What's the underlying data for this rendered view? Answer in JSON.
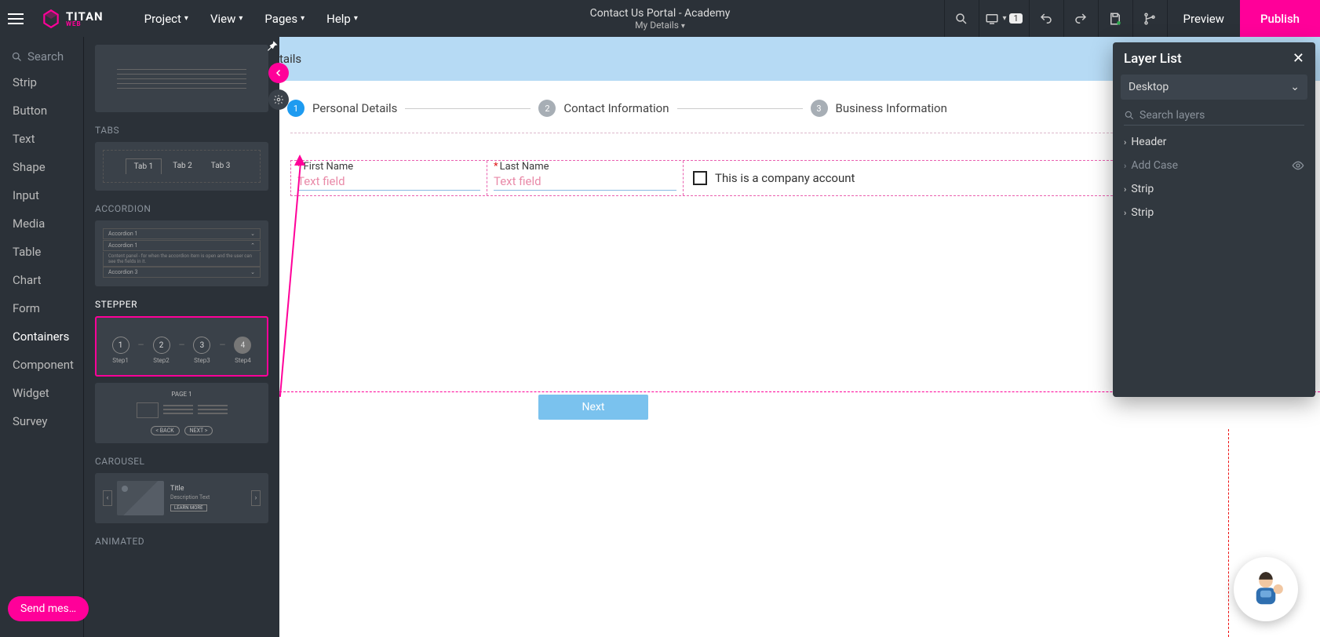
{
  "brand": {
    "name": "TITAN",
    "sub": "WEB"
  },
  "topmenu": {
    "project": "Project",
    "view": "View",
    "pages": "Pages",
    "help": "Help"
  },
  "doc": {
    "title": "Contact Us Portal - Academy",
    "page": "My Details"
  },
  "actions": {
    "preview": "Preview",
    "publish": "Publish"
  },
  "badges": {
    "device_count": "1"
  },
  "leftrail": {
    "search": "Search",
    "cats": [
      "Strip",
      "Button",
      "Text",
      "Shape",
      "Input",
      "Media",
      "Table",
      "Chart",
      "Form",
      "Containers",
      "Component",
      "Widget",
      "Survey"
    ],
    "active": "Containers"
  },
  "panel": {
    "sections": {
      "tabs": "TABS",
      "accordion": "ACCORDION",
      "stepper": "STEPPER",
      "carousel": "CAROUSEL",
      "animated": "ANIMATED"
    },
    "tabs_preview": [
      "Tab 1",
      "Tab 2",
      "Tab 3"
    ],
    "accordion_preview": {
      "row1": "Accordion 1",
      "row2": "Accordion 1",
      "row2b": "Content panel - for when the accordion item is open and the user can see the fields in it.",
      "row3": "Accordion 3"
    },
    "stepper_preview": {
      "s1": "Step1",
      "s2": "Step2",
      "s3": "Step3",
      "s4": "Step4"
    },
    "pager_preview": {
      "page": "PAGE 1",
      "back": "< BACK",
      "next": "NEXT >"
    },
    "carousel_preview": {
      "title": "Title",
      "desc": "Description Text",
      "cta": "LEARN MORE"
    }
  },
  "canvas": {
    "crumb": "tails",
    "steps": [
      {
        "n": "1",
        "label": "Personal Details",
        "active": true
      },
      {
        "n": "2",
        "label": "Contact Information",
        "active": false
      },
      {
        "n": "3",
        "label": "Business Information",
        "active": false
      }
    ],
    "fields": {
      "first_name_label": "First Name",
      "last_name_label": "Last Name",
      "placeholder": "Text field",
      "checkbox_label": "This is a company account"
    },
    "next": "Next"
  },
  "layer": {
    "title": "Layer List",
    "device": "Desktop",
    "search_ph": "Search layers",
    "items": [
      {
        "label": "Header",
        "dim": false
      },
      {
        "label": "Add Case",
        "dim": true,
        "eye": true
      },
      {
        "label": "Strip",
        "dim": false
      },
      {
        "label": "Strip",
        "dim": false
      }
    ]
  },
  "chat": {
    "send": "Send mes…"
  }
}
